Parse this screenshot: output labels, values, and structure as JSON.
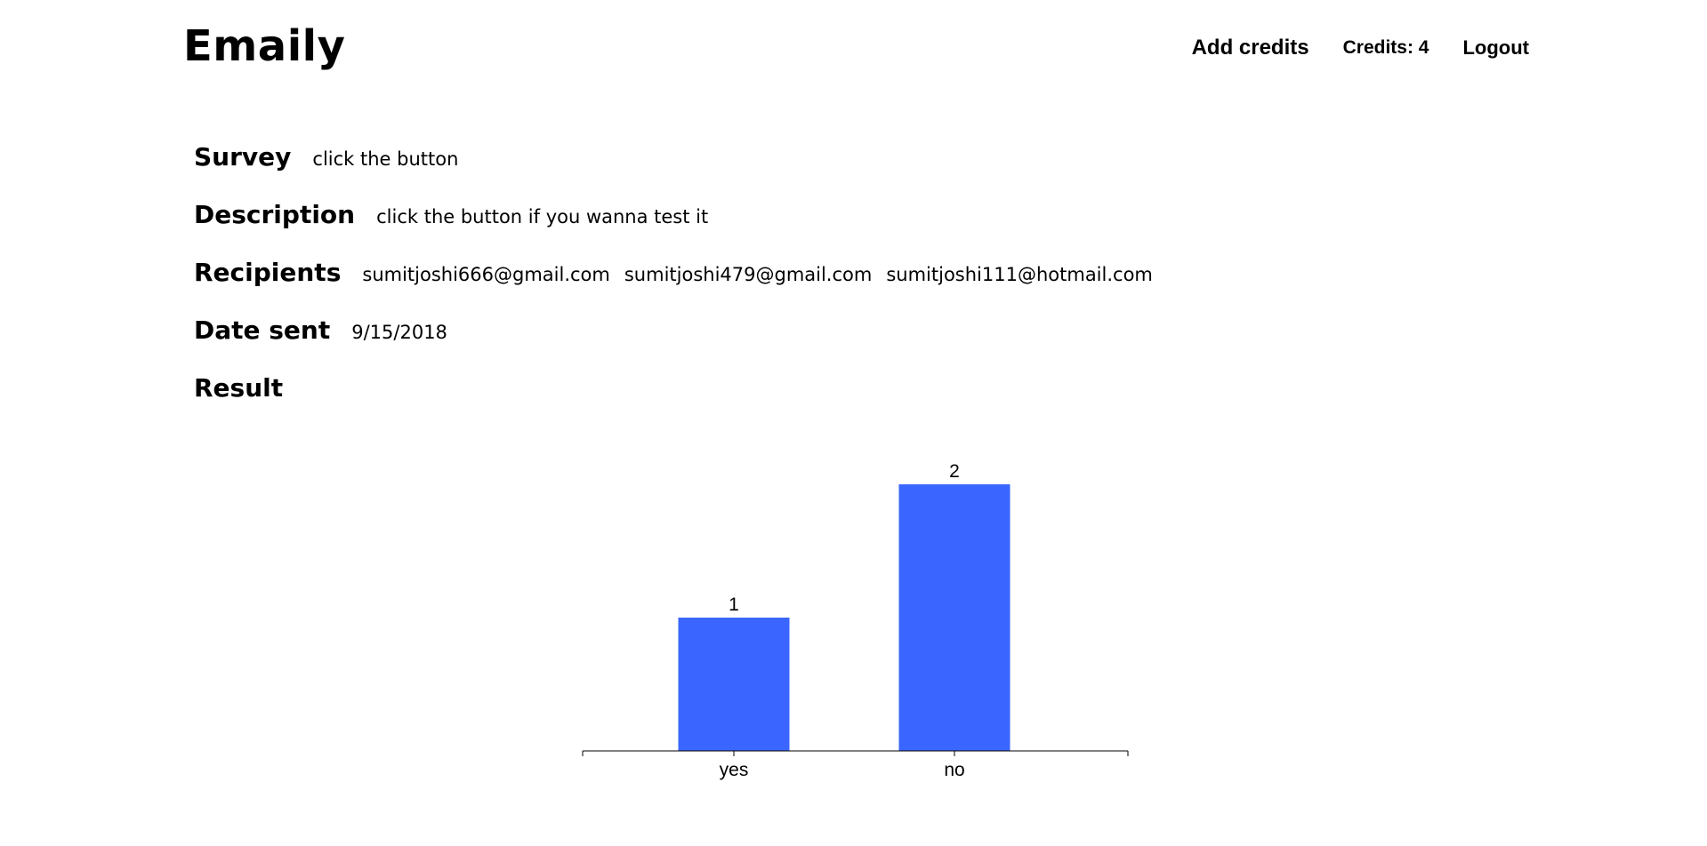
{
  "header": {
    "brand": "Emaily",
    "add_credits": "Add credits",
    "credits": "Credits: 4",
    "logout": "Logout"
  },
  "survey": {
    "survey_label": "Survey",
    "survey_value": "click the button",
    "description_label": "Description",
    "description_value": "click the button if you wanna test it",
    "recipients_label": "Recipients",
    "recipients": [
      "sumitjoshi666@gmail.com",
      "sumitjoshi479@gmail.com",
      "sumitjoshi111@hotmail.com"
    ],
    "date_label": "Date sent",
    "date_value": "9/15/2018",
    "result_label": "Result"
  },
  "colors": {
    "bar": "#3a66ff",
    "axis": "#000000"
  },
  "chart_data": {
    "type": "bar",
    "categories": [
      "yes",
      "no"
    ],
    "values": [
      1,
      2
    ],
    "data_labels": [
      "1",
      "2"
    ],
    "title": "",
    "xlabel": "",
    "ylabel": "",
    "ylim": [
      0,
      2
    ],
    "grid": false
  }
}
